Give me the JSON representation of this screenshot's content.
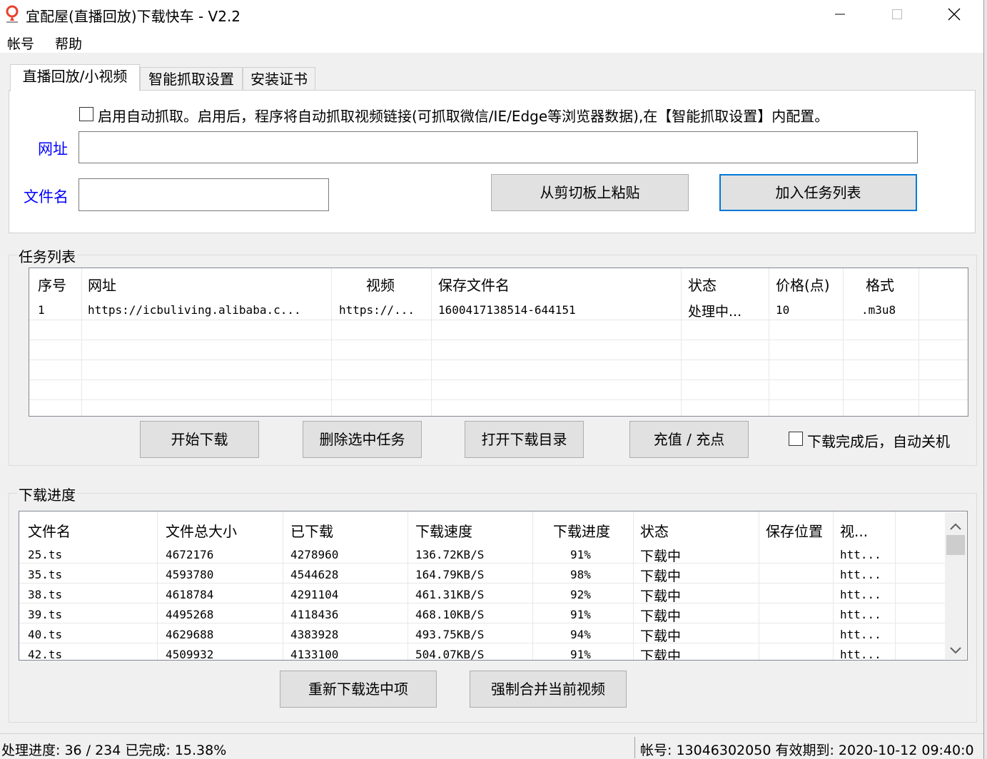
{
  "window": {
    "title": "宜配屋(直播回放)下载快车 - V2.2"
  },
  "menu": [
    "帐号",
    "帮助"
  ],
  "tabs": [
    "直播回放/小视频",
    "智能抓取设置",
    "安装证书"
  ],
  "form": {
    "auto_capture_label": "启用自动抓取。启用后，程序将自动抓取视频链接(可抓取微信/IE/Edge等浏览器数据),在【智能抓取设置】内配置。",
    "url_label": "网址",
    "url_value": "",
    "filename_label": "文件名",
    "filename_value": "",
    "paste_button": "从剪切板上粘贴",
    "add_button": "加入任务列表"
  },
  "task_list": {
    "title": "任务列表",
    "columns": [
      "序号",
      "网址",
      "视频",
      "保存文件名",
      "状态",
      "价格(点)",
      "格式"
    ],
    "rows": [
      [
        "1",
        "https://icbuliving.alibaba.c...",
        "https://...",
        "1600417138514-644151",
        "处理中...",
        "10",
        ".m3u8"
      ]
    ],
    "buttons": [
      "开始下载",
      "删除选中任务",
      "打开下载目录",
      "充值 / 充点"
    ],
    "shutdown_label": "下载完成后，自动关机"
  },
  "progress": {
    "title": "下载进度",
    "columns": [
      "文件名",
      "文件总大小",
      "已下载",
      "下载速度",
      "下载进度",
      "状态",
      "保存位置",
      "视..."
    ],
    "rows": [
      [
        "25.ts",
        "4672176",
        "4278960",
        "136.72KB/S",
        "91%",
        "下载中",
        "",
        "htt..."
      ],
      [
        "35.ts",
        "4593780",
        "4544628",
        "164.79KB/S",
        "98%",
        "下载中",
        "",
        "htt..."
      ],
      [
        "38.ts",
        "4618784",
        "4291104",
        "461.31KB/S",
        "92%",
        "下载中",
        "",
        "htt..."
      ],
      [
        "39.ts",
        "4495268",
        "4118436",
        "468.10KB/S",
        "91%",
        "下载中",
        "",
        "htt..."
      ],
      [
        "40.ts",
        "4629688",
        "4383928",
        "493.75KB/S",
        "94%",
        "下载中",
        "",
        "htt..."
      ],
      [
        "42.ts",
        "4509932",
        "4133100",
        "504.07KB/S",
        "91%",
        "下载中",
        "",
        "htt..."
      ]
    ],
    "buttons": [
      "重新下载选中项",
      "强制合并当前视频"
    ]
  },
  "status": {
    "left": "处理进度: 36 / 234 已完成: 15.38%",
    "right": "帐号: 13046302050 有效期到: 2020-10-12 09:40:0"
  },
  "colors": {
    "accent": "#0078d7",
    "label_blue": "#0000ff",
    "app_icon": "#e8412c"
  }
}
